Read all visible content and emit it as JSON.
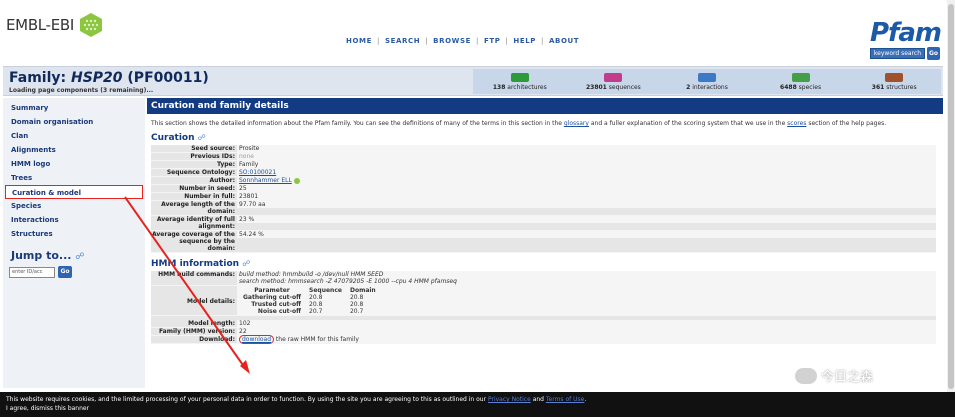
{
  "header": {
    "ebi_logo": "EMBL-EBI",
    "nav": [
      "HOME",
      "SEARCH",
      "BROWSE",
      "FTP",
      "HELP",
      "ABOUT"
    ],
    "pfam_logo": "Pfam",
    "keyword_search": "keyword search",
    "go_label": "Go"
  },
  "family": {
    "prefix": "Family: ",
    "name": "HSP20",
    "accession": " (PF00011)",
    "loading": "Loading page components (3 remaining)..."
  },
  "stats": [
    {
      "count": "138",
      "label": "architectures",
      "color": "#2e9b3a"
    },
    {
      "count": "23801",
      "label": "sequences",
      "color": "#c23b8c"
    },
    {
      "count": "2",
      "label": "interactions",
      "color": "#3c7ac8"
    },
    {
      "count": "6488",
      "label": "species",
      "color": "#43a047"
    },
    {
      "count": "361",
      "label": "structures",
      "color": "#a0522d"
    }
  ],
  "sidebar": {
    "items": [
      "Summary",
      "Domain organisation",
      "Clan",
      "Alignments",
      "HMM logo",
      "Trees",
      "Curation & model",
      "Species",
      "Interactions",
      "Structures"
    ],
    "jump_title": "Jump to...",
    "jump_placeholder": "enter ID/acc",
    "jump_go": "Go"
  },
  "main": {
    "section_title": "Curation and family details",
    "intro_pre": "This section shows the detailed information about the Pfam family. You can see the definitions of many of the terms in this section in the ",
    "intro_glossary": "glossary",
    "intro_mid": " and a fuller explanation of the scoring system that we use in the ",
    "intro_scores": "scores",
    "intro_post": " section of the help pages.",
    "curation_title": "Curation",
    "curation": [
      {
        "key": "Seed source:",
        "value": "Prosite"
      },
      {
        "key": "Previous IDs:",
        "value": "none"
      },
      {
        "key": "Type:",
        "value": "Family"
      },
      {
        "key": "Sequence Ontology:",
        "value": "SO:0100021"
      },
      {
        "key": "Author:",
        "value": "Sonnhammer ELL"
      },
      {
        "key": "Number in seed:",
        "value": "25"
      },
      {
        "key": "Number in full:",
        "value": "23801"
      },
      {
        "key": "Average length of the domain:",
        "value": "97.70 aa"
      },
      {
        "key": "Average identity of full alignment:",
        "value": "23 %"
      },
      {
        "key": "Average coverage of the sequence by the domain:",
        "value": "54.24 %"
      }
    ],
    "hmm_title": "HMM information",
    "build_key": "HMM build commands:",
    "build_method": "build method: hmmbuild -o /dev/null HMM SEED",
    "search_method": "search method: hmmsearch -Z 47079205 -E 1000 --cpu 4 HMM pfamseq",
    "model_details_key": "Model details:",
    "model_table": {
      "headers": [
        "Parameter",
        "Sequence",
        "Domain"
      ],
      "rows": [
        [
          "Gathering cut-off",
          "20.8",
          "20.8"
        ],
        [
          "Trusted cut-off",
          "20.8",
          "20.8"
        ],
        [
          "Noise cut-off",
          "20.7",
          "20.7"
        ]
      ]
    },
    "model_length_key": "Model length:",
    "model_length": "102",
    "version_key": "Family (HMM) version:",
    "version": "22",
    "download_key": "Download:",
    "download_link": "download",
    "download_text": " the raw HMM for this family"
  },
  "watermark": "今日之森",
  "cookie": {
    "text": "This website requires cookies, and the limited processing of your personal data in order to function. By using the site you are agreeing to this as outlined in our ",
    "privacy": "Privacy Notice",
    "and": " and ",
    "terms": "Terms of Use",
    "dismiss": "I agree, dismiss this banner"
  }
}
